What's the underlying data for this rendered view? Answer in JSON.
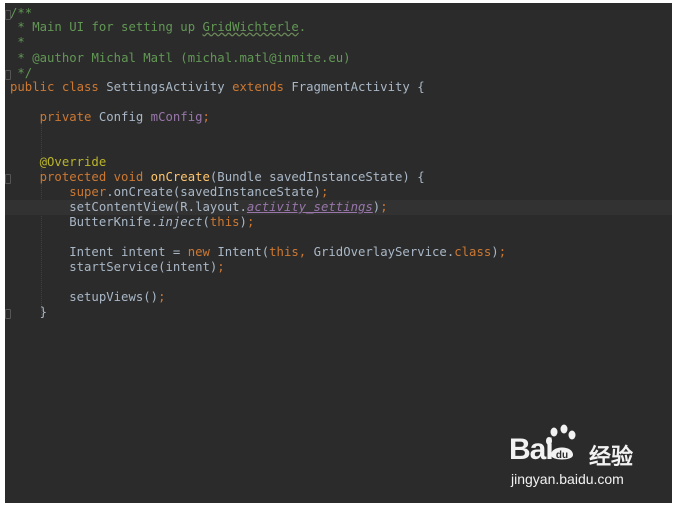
{
  "code": {
    "l1": "/**",
    "l2_star": " * ",
    "l2_text": "Main UI for setting up ",
    "l2_typo": "GridWichterle",
    "l2_end": ".",
    "l3": " *",
    "l4_star": " * ",
    "l4_tag": "@author",
    "l4_text": " Michal Matl (michal.matl@inmite.eu)",
    "l5": " */",
    "l6_kw": "public class ",
    "l6_name": "SettingsActivity ",
    "l6_kw2": "extends ",
    "l6_rest": "FragmentActivity {",
    "l7_kw": "    private ",
    "l7_type": "Config ",
    "l7_field": "mConfig",
    "l7_end": ";",
    "l8_ann": "    @Override",
    "l9_kw": "    protected void ",
    "l9_fn": "onCreate",
    "l9_rest": "(Bundle savedInstanceState) {",
    "l10_kw": "        super",
    "l10_rest": ".onCreate(savedInstanceState)",
    "l10_end": ";",
    "l11_a": "        setContentView(R.layout.",
    "l11_link": "activity_settings",
    "l11_b": ")",
    "l11_end": ";",
    "l12_a": "        ButterKnife.",
    "l12_it": "inject",
    "l12_b": "(",
    "l12_kw": "this",
    "l12_c": ")",
    "l12_end": ";",
    "l13_a": "        Intent intent = ",
    "l13_kw": "new ",
    "l13_b": "Intent(",
    "l13_kw2": "this",
    "l13_c": ", ",
    "l13_d": "GridOverlayService.",
    "l13_kw3": "class",
    "l13_e": ")",
    "l13_end": ";",
    "l14_a": "        startService(intent)",
    "l14_end": ";",
    "l15_a": "        setupViews()",
    "l15_end": ";",
    "l16": "    }"
  },
  "watermark": {
    "logo": "Bai",
    "logo2": "du",
    "cn": "经验",
    "url": "jingyan.baidu.com"
  }
}
